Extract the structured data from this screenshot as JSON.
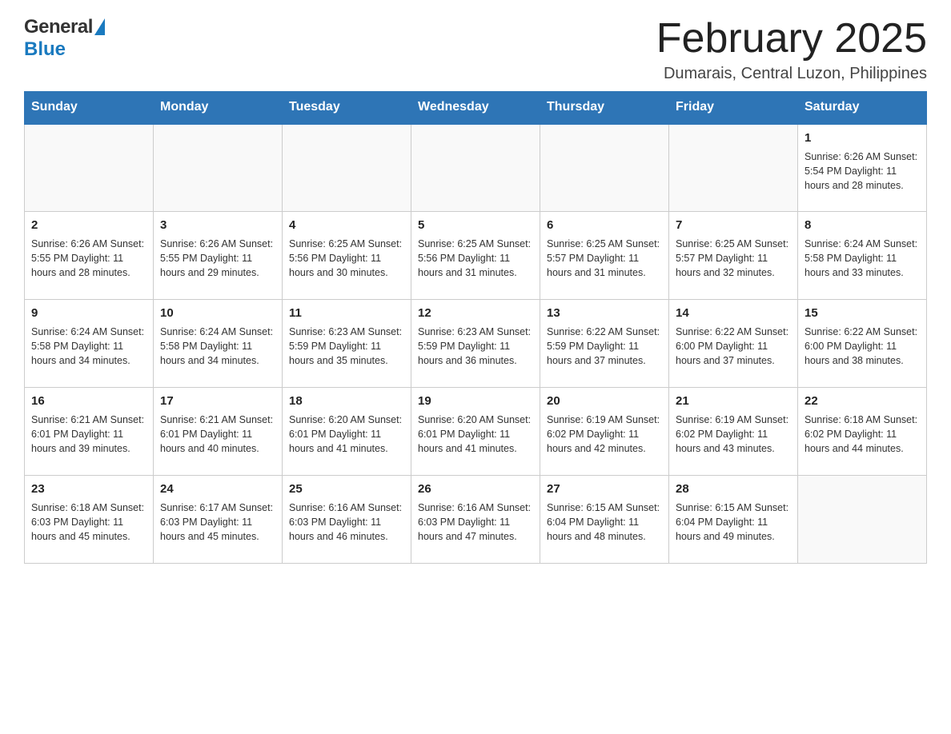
{
  "header": {
    "logo_general": "General",
    "logo_blue": "Blue",
    "title": "February 2025",
    "subtitle": "Dumarais, Central Luzon, Philippines"
  },
  "calendar": {
    "days_of_week": [
      "Sunday",
      "Monday",
      "Tuesday",
      "Wednesday",
      "Thursday",
      "Friday",
      "Saturday"
    ],
    "weeks": [
      [
        {
          "day": "",
          "info": ""
        },
        {
          "day": "",
          "info": ""
        },
        {
          "day": "",
          "info": ""
        },
        {
          "day": "",
          "info": ""
        },
        {
          "day": "",
          "info": ""
        },
        {
          "day": "",
          "info": ""
        },
        {
          "day": "1",
          "info": "Sunrise: 6:26 AM\nSunset: 5:54 PM\nDaylight: 11 hours and 28 minutes."
        }
      ],
      [
        {
          "day": "2",
          "info": "Sunrise: 6:26 AM\nSunset: 5:55 PM\nDaylight: 11 hours and 28 minutes."
        },
        {
          "day": "3",
          "info": "Sunrise: 6:26 AM\nSunset: 5:55 PM\nDaylight: 11 hours and 29 minutes."
        },
        {
          "day": "4",
          "info": "Sunrise: 6:25 AM\nSunset: 5:56 PM\nDaylight: 11 hours and 30 minutes."
        },
        {
          "day": "5",
          "info": "Sunrise: 6:25 AM\nSunset: 5:56 PM\nDaylight: 11 hours and 31 minutes."
        },
        {
          "day": "6",
          "info": "Sunrise: 6:25 AM\nSunset: 5:57 PM\nDaylight: 11 hours and 31 minutes."
        },
        {
          "day": "7",
          "info": "Sunrise: 6:25 AM\nSunset: 5:57 PM\nDaylight: 11 hours and 32 minutes."
        },
        {
          "day": "8",
          "info": "Sunrise: 6:24 AM\nSunset: 5:58 PM\nDaylight: 11 hours and 33 minutes."
        }
      ],
      [
        {
          "day": "9",
          "info": "Sunrise: 6:24 AM\nSunset: 5:58 PM\nDaylight: 11 hours and 34 minutes."
        },
        {
          "day": "10",
          "info": "Sunrise: 6:24 AM\nSunset: 5:58 PM\nDaylight: 11 hours and 34 minutes."
        },
        {
          "day": "11",
          "info": "Sunrise: 6:23 AM\nSunset: 5:59 PM\nDaylight: 11 hours and 35 minutes."
        },
        {
          "day": "12",
          "info": "Sunrise: 6:23 AM\nSunset: 5:59 PM\nDaylight: 11 hours and 36 minutes."
        },
        {
          "day": "13",
          "info": "Sunrise: 6:22 AM\nSunset: 5:59 PM\nDaylight: 11 hours and 37 minutes."
        },
        {
          "day": "14",
          "info": "Sunrise: 6:22 AM\nSunset: 6:00 PM\nDaylight: 11 hours and 37 minutes."
        },
        {
          "day": "15",
          "info": "Sunrise: 6:22 AM\nSunset: 6:00 PM\nDaylight: 11 hours and 38 minutes."
        }
      ],
      [
        {
          "day": "16",
          "info": "Sunrise: 6:21 AM\nSunset: 6:01 PM\nDaylight: 11 hours and 39 minutes."
        },
        {
          "day": "17",
          "info": "Sunrise: 6:21 AM\nSunset: 6:01 PM\nDaylight: 11 hours and 40 minutes."
        },
        {
          "day": "18",
          "info": "Sunrise: 6:20 AM\nSunset: 6:01 PM\nDaylight: 11 hours and 41 minutes."
        },
        {
          "day": "19",
          "info": "Sunrise: 6:20 AM\nSunset: 6:01 PM\nDaylight: 11 hours and 41 minutes."
        },
        {
          "day": "20",
          "info": "Sunrise: 6:19 AM\nSunset: 6:02 PM\nDaylight: 11 hours and 42 minutes."
        },
        {
          "day": "21",
          "info": "Sunrise: 6:19 AM\nSunset: 6:02 PM\nDaylight: 11 hours and 43 minutes."
        },
        {
          "day": "22",
          "info": "Sunrise: 6:18 AM\nSunset: 6:02 PM\nDaylight: 11 hours and 44 minutes."
        }
      ],
      [
        {
          "day": "23",
          "info": "Sunrise: 6:18 AM\nSunset: 6:03 PM\nDaylight: 11 hours and 45 minutes."
        },
        {
          "day": "24",
          "info": "Sunrise: 6:17 AM\nSunset: 6:03 PM\nDaylight: 11 hours and 45 minutes."
        },
        {
          "day": "25",
          "info": "Sunrise: 6:16 AM\nSunset: 6:03 PM\nDaylight: 11 hours and 46 minutes."
        },
        {
          "day": "26",
          "info": "Sunrise: 6:16 AM\nSunset: 6:03 PM\nDaylight: 11 hours and 47 minutes."
        },
        {
          "day": "27",
          "info": "Sunrise: 6:15 AM\nSunset: 6:04 PM\nDaylight: 11 hours and 48 minutes."
        },
        {
          "day": "28",
          "info": "Sunrise: 6:15 AM\nSunset: 6:04 PM\nDaylight: 11 hours and 49 minutes."
        },
        {
          "day": "",
          "info": ""
        }
      ]
    ]
  }
}
